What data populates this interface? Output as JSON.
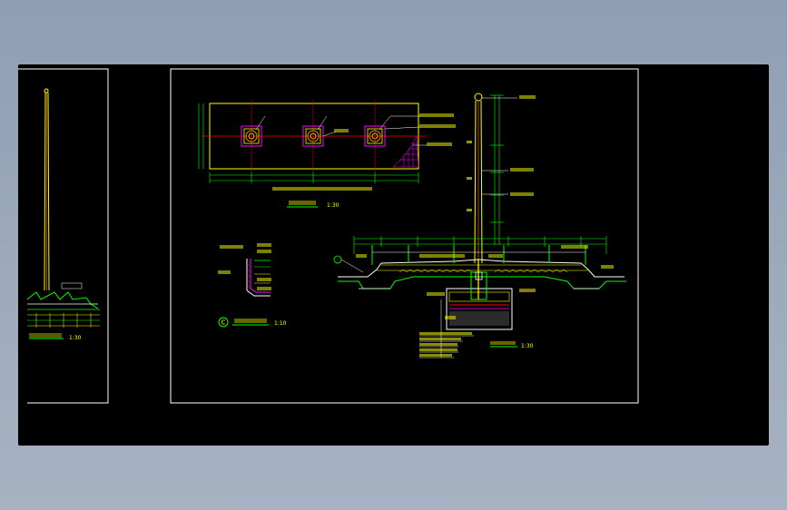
{
  "colors": {
    "background_gradient_top": "#8f9eb2",
    "viewport": "#000000",
    "sheet_border": "#ffffff",
    "yellow": "#ffff00",
    "green": "#00ff00",
    "red": "#ff0000",
    "magenta": "#ff00ff",
    "white": "#ffffff",
    "cyan": "#00ffff"
  },
  "drawing": {
    "left_sheet": {
      "scale_label": "1:30"
    },
    "main_sheet": {
      "plan_view": {
        "scale_label": "1:30"
      },
      "detail_c": {
        "marker_letter": "C",
        "scale_label": "1:10"
      },
      "section": {
        "scale_label": "1:30"
      }
    }
  }
}
